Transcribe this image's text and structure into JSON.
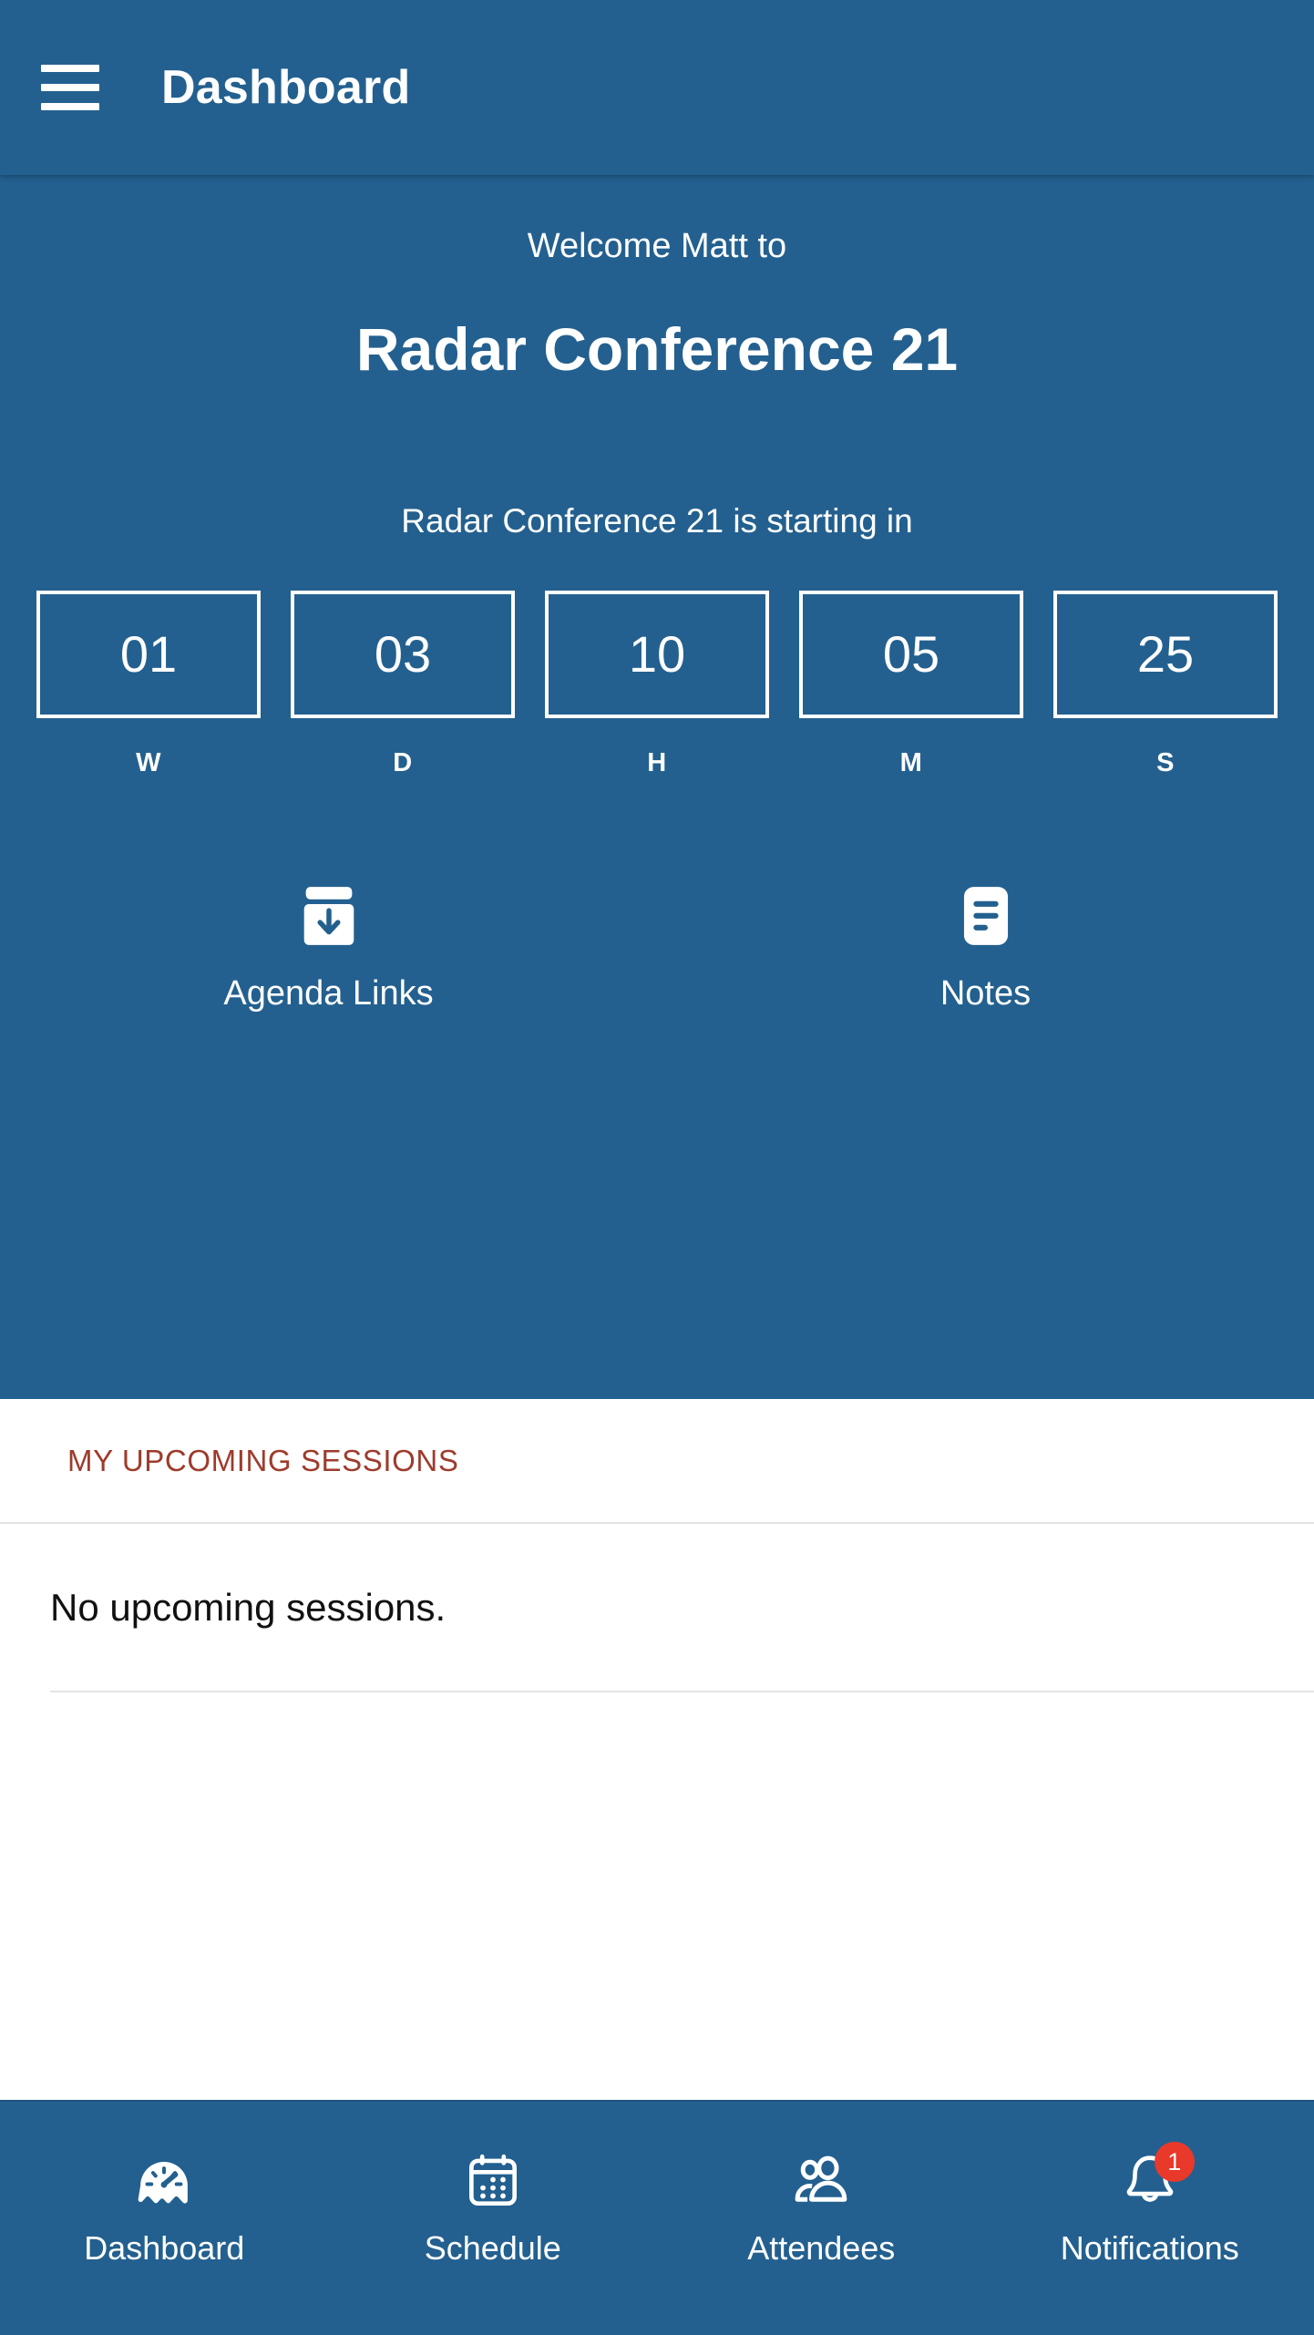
{
  "theme": {
    "primary": "#23608f",
    "accent_heading": "#9e3b2c",
    "badge": "#e8392a",
    "on_primary": "#ffffff"
  },
  "appbar": {
    "menu_icon": "hamburger-menu-icon",
    "title": "Dashboard"
  },
  "hero": {
    "welcome": "Welcome Matt to",
    "event_title": "Radar Conference 21",
    "countdown_intro": "Radar Conference 21 is starting in",
    "countdown": [
      {
        "value": "01",
        "label": "W"
      },
      {
        "value": "03",
        "label": "D"
      },
      {
        "value": "10",
        "label": "H"
      },
      {
        "value": "05",
        "label": "M"
      },
      {
        "value": "25",
        "label": "S"
      }
    ],
    "quick_links": [
      {
        "label": "Agenda Links",
        "icon": "archive-download-icon"
      },
      {
        "label": "Notes",
        "icon": "document-lines-icon"
      }
    ]
  },
  "sessions": {
    "section_title": "MY UPCOMING SESSIONS",
    "empty_text": "No upcoming sessions."
  },
  "bottom_nav": {
    "items": [
      {
        "label": "Dashboard",
        "icon": "gauge-icon",
        "active": true,
        "badge": ""
      },
      {
        "label": "Schedule",
        "icon": "calendar-icon",
        "active": false,
        "badge": ""
      },
      {
        "label": "Attendees",
        "icon": "people-icon",
        "active": false,
        "badge": ""
      },
      {
        "label": "Notifications",
        "icon": "bell-icon",
        "active": false,
        "badge": "1"
      }
    ]
  }
}
